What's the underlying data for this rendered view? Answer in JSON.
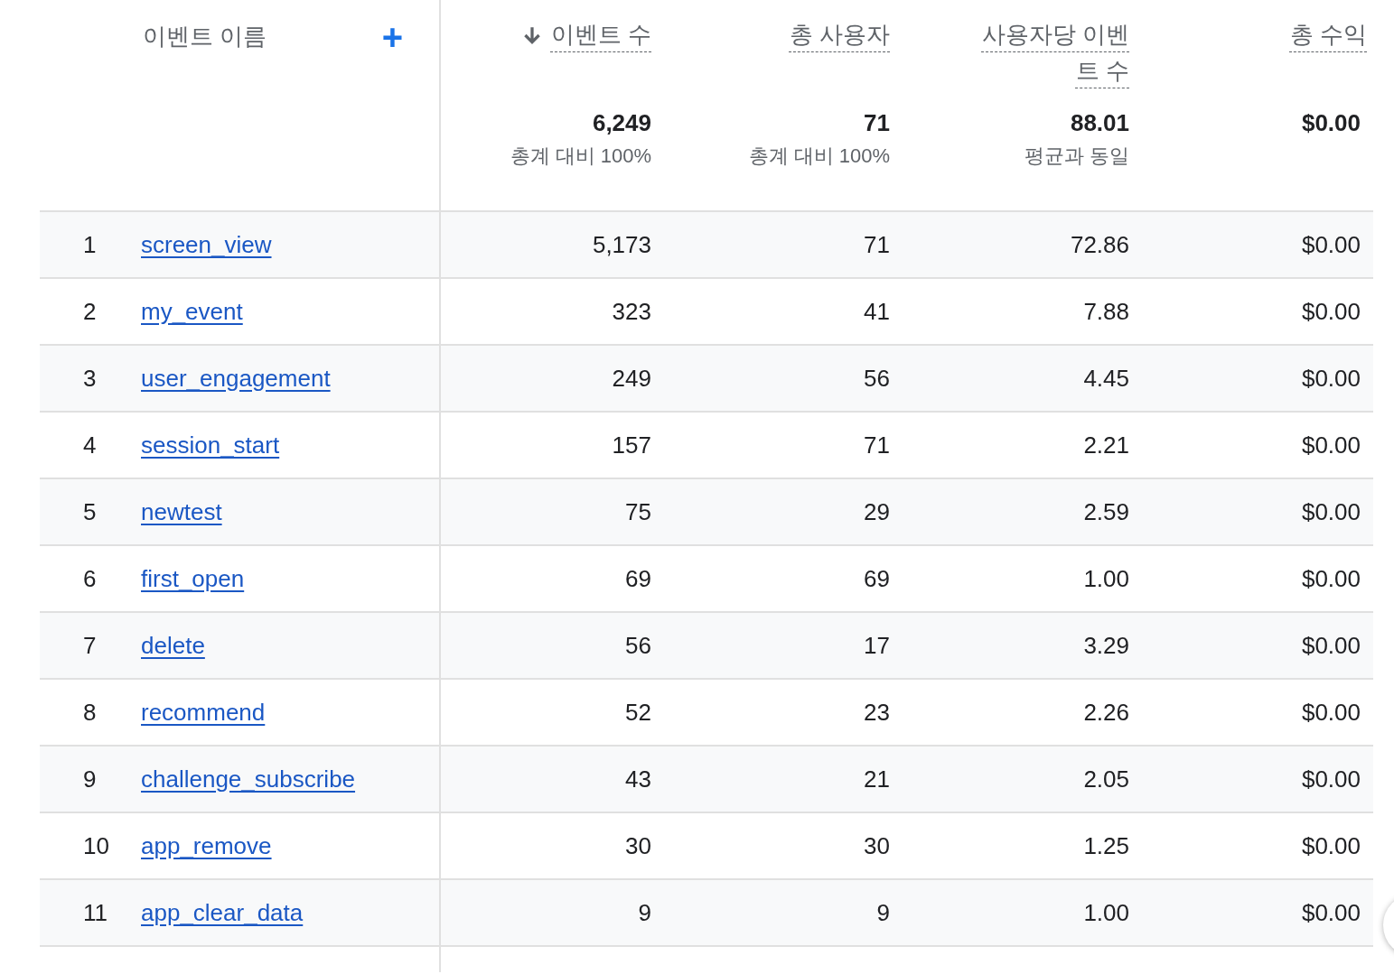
{
  "dimension_header": {
    "label": "이벤트 이름",
    "add_button": "+"
  },
  "columns": [
    {
      "label": "이벤트 수",
      "sorted": true,
      "total": "6,249",
      "total_note": "총계 대비 100%"
    },
    {
      "label": "총 사용자",
      "sorted": false,
      "total": "71",
      "total_note": "총계 대비 100%"
    },
    {
      "label": "사용자당 이벤트 수",
      "sorted": false,
      "total": "88.01",
      "total_note": "평균과 동일"
    },
    {
      "label": "총 수익",
      "sorted": false,
      "total": "$0.00"
    }
  ],
  "rows": [
    {
      "index": "1",
      "name": "screen_view",
      "values": [
        "5,173",
        "71",
        "72.86",
        "$0.00"
      ]
    },
    {
      "index": "2",
      "name": "my_event",
      "values": [
        "323",
        "41",
        "7.88",
        "$0.00"
      ]
    },
    {
      "index": "3",
      "name": "user_engagement",
      "values": [
        "249",
        "56",
        "4.45",
        "$0.00"
      ]
    },
    {
      "index": "4",
      "name": "session_start",
      "values": [
        "157",
        "71",
        "2.21",
        "$0.00"
      ]
    },
    {
      "index": "5",
      "name": "newtest",
      "values": [
        "75",
        "29",
        "2.59",
        "$0.00"
      ]
    },
    {
      "index": "6",
      "name": "first_open",
      "values": [
        "69",
        "69",
        "1.00",
        "$0.00"
      ]
    },
    {
      "index": "7",
      "name": "delete",
      "values": [
        "56",
        "17",
        "3.29",
        "$0.00"
      ]
    },
    {
      "index": "8",
      "name": "recommend",
      "values": [
        "52",
        "23",
        "2.26",
        "$0.00"
      ]
    },
    {
      "index": "9",
      "name": "challenge_subscribe",
      "values": [
        "43",
        "21",
        "2.05",
        "$0.00"
      ]
    },
    {
      "index": "10",
      "name": "app_remove",
      "values": [
        "30",
        "30",
        "1.25",
        "$0.00"
      ]
    },
    {
      "index": "11",
      "name": "app_clear_data",
      "values": [
        "9",
        "9",
        "1.00",
        "$0.00"
      ]
    }
  ]
}
